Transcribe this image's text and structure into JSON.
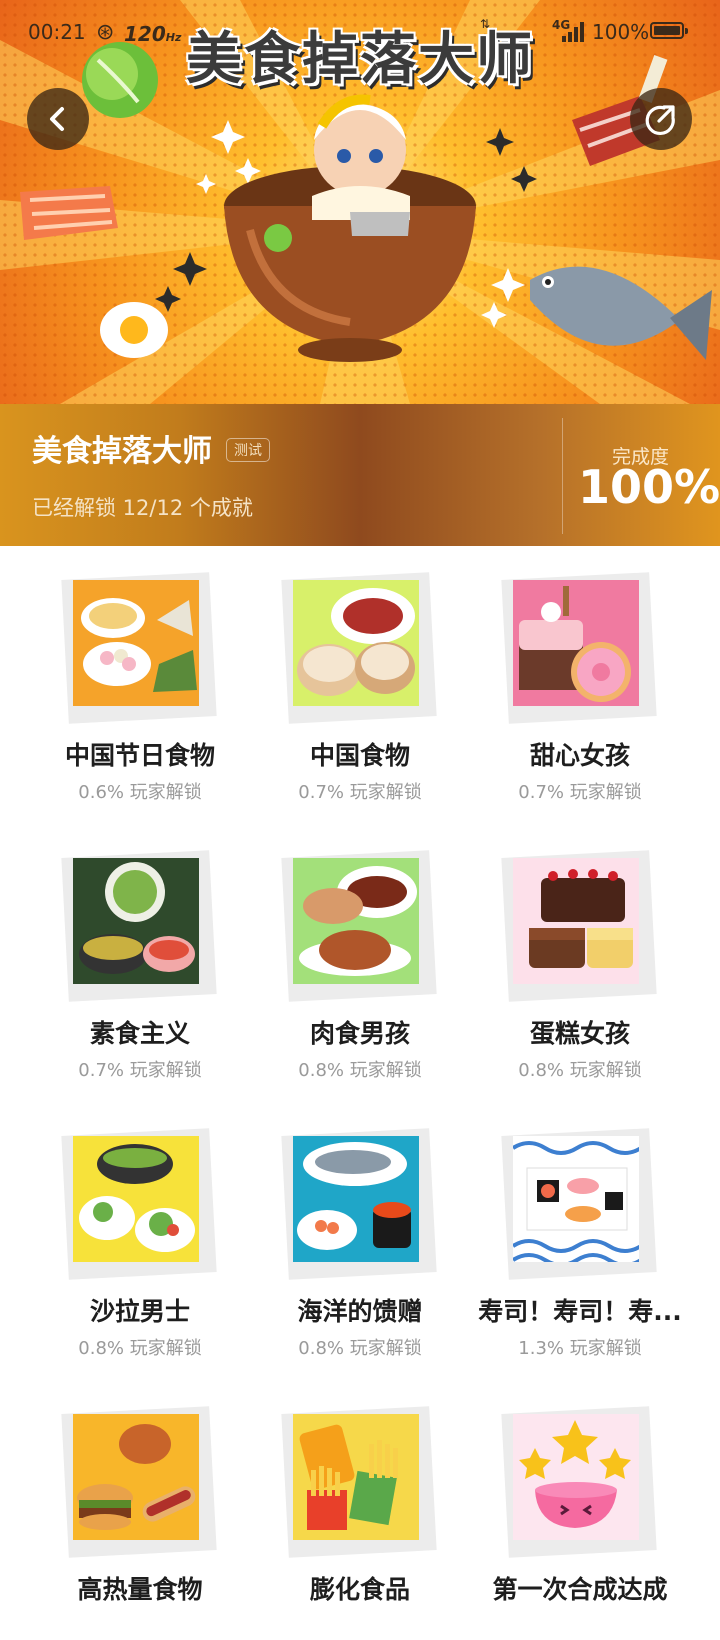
{
  "status_bar": {
    "time": "00:21",
    "refresh_rate": "120",
    "refresh_unit": "Hz",
    "network": "4G",
    "battery": "100%"
  },
  "banner": {
    "title": "美食掉落大师"
  },
  "achievement": {
    "name": "美食掉落大师",
    "tag": "测试",
    "unlocked_text": "已经解锁 12/12 个成就",
    "completion_label": "完成度",
    "completion_value": "100%"
  },
  "items": [
    {
      "title": "中国节日食物",
      "percent": "0.6% 玩家解锁",
      "icon": "festival-food-icon",
      "bg": "#f5a32a"
    },
    {
      "title": "中国食物",
      "percent": "0.7% 玩家解锁",
      "icon": "dumplings-icon",
      "bg": "#d8f06a"
    },
    {
      "title": "甜心女孩",
      "percent": "0.7% 玩家解锁",
      "icon": "cake-donut-icon",
      "bg": "#f07aa0"
    },
    {
      "title": "素食主义",
      "percent": "0.7% 玩家解锁",
      "icon": "vegetarian-icon",
      "bg": "#2f4a2c"
    },
    {
      "title": "肉食男孩",
      "percent": "0.8% 玩家解锁",
      "icon": "roast-meat-icon",
      "bg": "#a3e07a"
    },
    {
      "title": "蛋糕女孩",
      "percent": "0.8% 玩家解锁",
      "icon": "cakes-icon",
      "bg": "#fde0ea"
    },
    {
      "title": "沙拉男士",
      "percent": "0.8% 玩家解锁",
      "icon": "salad-icon",
      "bg": "#f7e23a"
    },
    {
      "title": "海洋的馈赠",
      "percent": "0.8% 玩家解锁",
      "icon": "seafood-icon",
      "bg": "#1fa6c8"
    },
    {
      "title": "寿司！寿司！寿...",
      "percent": "1.3% 玩家解锁",
      "icon": "sushi-icon",
      "bg": "#3d7fd0"
    },
    {
      "title": "高热量食物",
      "percent": "",
      "icon": "fast-food-icon",
      "bg": "#f8b62a"
    },
    {
      "title": "膨化食品",
      "percent": "",
      "icon": "snacks-icon",
      "bg": "#f6d84a"
    },
    {
      "title": "第一次合成达成",
      "percent": "",
      "icon": "stars-bowl-icon",
      "bg": "#fde6ef"
    }
  ]
}
